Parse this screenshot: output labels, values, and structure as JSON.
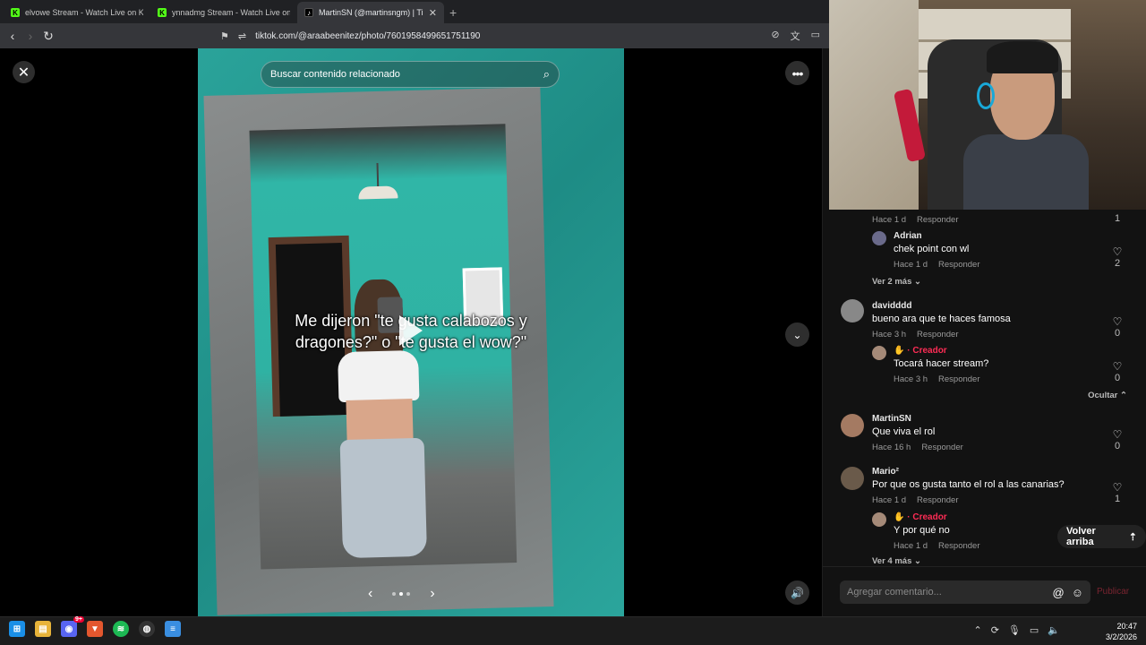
{
  "browser": {
    "tabs": [
      {
        "label": "elvowe Stream - Watch Live on Kick",
        "icon": "kick-icon",
        "active": false
      },
      {
        "label": "ynnadmg Stream - Watch Live on Kick",
        "icon": "kick-icon",
        "active": false
      },
      {
        "label": "MartinSN (@martinsngm) | TikTo",
        "icon": "tiktok-icon",
        "active": true
      }
    ],
    "url": "tiktok.com/@araabeenitez/photo/7601958499651751190"
  },
  "viewer": {
    "search_placeholder": "Buscar contenido relacionado",
    "caption": "Me dijeron \"te gusta calabozos y dragones?\" o \"te gusta el wow?\"",
    "slide_count": 3,
    "active_slide_index": 1
  },
  "comments": [
    {
      "id": "c0",
      "meta_time": "Hace 1 d",
      "reply_label": "Responder",
      "likes": "1"
    },
    {
      "id": "c1",
      "user": "Adrian",
      "text": "chek point con wl",
      "meta_time": "Hace 1 d",
      "reply_label": "Responder",
      "likes": "2"
    },
    {
      "id": "more1",
      "label": "Ver 2 más"
    },
    {
      "id": "c2",
      "user": "davidddd",
      "text": "bueno ara que te haces famosa",
      "meta_time": "Hace 3 h",
      "reply_label": "Responder",
      "likes": "0"
    },
    {
      "id": "c3",
      "creator_label": "· Creador",
      "text": "Tocará hacer stream?",
      "meta_time": "Hace 3 h",
      "reply_label": "Responder",
      "likes": "0"
    },
    {
      "id": "hide1",
      "label": "Ocultar"
    },
    {
      "id": "c4",
      "user": "MartinSN",
      "text": "Que viva el rol",
      "meta_time": "Hace 16 h",
      "reply_label": "Responder",
      "likes": "0"
    },
    {
      "id": "c5",
      "user": "Mario²",
      "text": "Por que os gusta tanto el rol a las canarias?",
      "meta_time": "Hace 1 d",
      "reply_label": "Responder",
      "likes": "1"
    },
    {
      "id": "c6",
      "creator_label": "· Creador",
      "text": "Y por qué no",
      "meta_time": "Hace 1 d",
      "reply_label": "Responder"
    },
    {
      "id": "more2",
      "label": "Ver 4 más"
    }
  ],
  "back_to_top": "Volver arriba",
  "comment_bar": {
    "placeholder": "Agregar comentario...",
    "publish_label": "Publicar"
  },
  "taskbar": {
    "time": "20:47",
    "date": "3/2/2026",
    "discord_badge": "9+"
  },
  "colors": {
    "creator": "#fe2c55",
    "kick": "#53fc18",
    "teal": "#2aa39a"
  }
}
